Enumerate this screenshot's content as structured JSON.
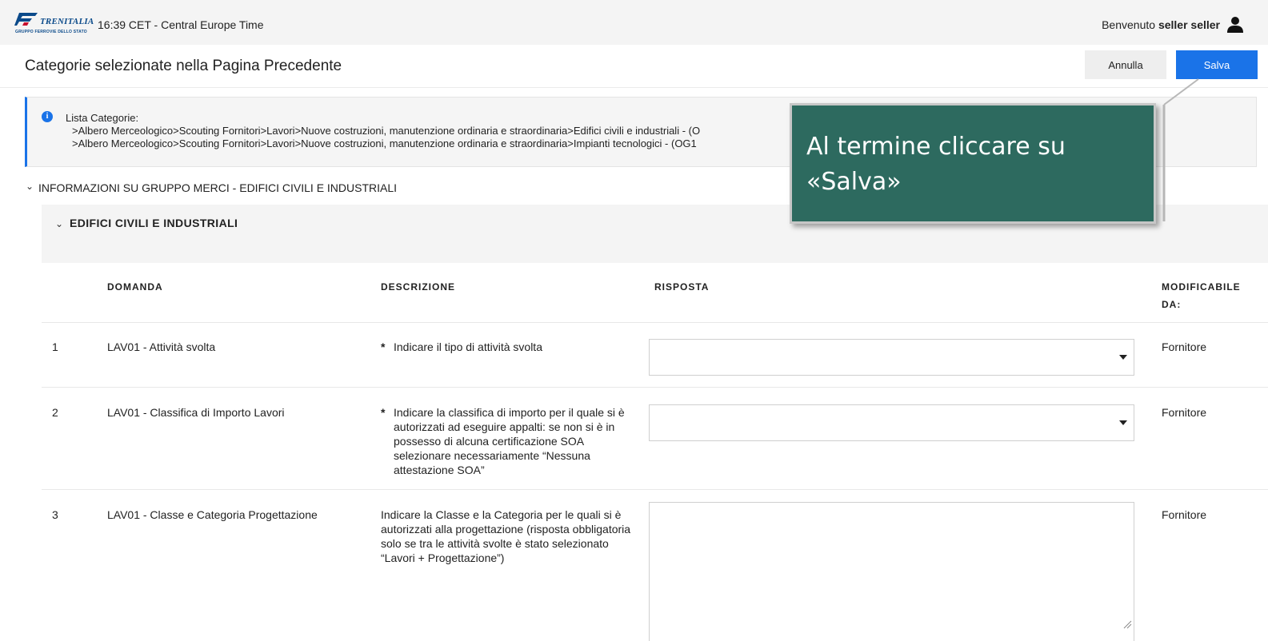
{
  "topbar": {
    "brand": "TRENITALIA",
    "brand_sub": "GRUPPO FERROVIE DELLO STATO",
    "clock": "16:39 CET - Central Europe Time",
    "welcome_prefix": "Benvenuto",
    "welcome_user": "seller seller",
    "user_icon": "user-icon"
  },
  "header": {
    "title": "Categorie selezionate nella Pagina Precedente",
    "cancel_label": "Annulla",
    "save_label": "Salva"
  },
  "info": {
    "icon": "info-icon",
    "title": "Lista Categorie:",
    "line1": ">Albero Merceologico>Scouting Fornitori>Lavori>Nuove costruzioni, manutenzione ordinaria e straordinaria>Edifici civili e industriali - (O",
    "line2": ">Albero Merceologico>Scouting Fornitori>Lavori>Nuove costruzioni, manutenzione ordinaria e straordinaria>Impianti tecnologici - (OG1"
  },
  "section": {
    "title": "INFORMAZIONI SU GRUPPO MERCI - EDIFICI CIVILI E INDUSTRIALI",
    "group_title": "EDIFICI CIVILI E INDUSTRIALI"
  },
  "table": {
    "headers": {
      "domanda": "DOMANDA",
      "descrizione": "DESCRIZIONE",
      "risposta": "RISPOSTA",
      "modificabile_1": "MODIFICABILE",
      "modificabile_2": "DA:"
    },
    "rows": [
      {
        "num": "1",
        "domanda": "LAV01 - Attività svolta",
        "required": "*",
        "descrizione": "Indicare il tipo di attività svolta",
        "risposta": "",
        "modificabile": "Fornitore"
      },
      {
        "num": "2",
        "domanda": "LAV01 - Classifica di Importo Lavori",
        "required": "*",
        "descrizione": "Indicare la classifica di importo per il quale si è autorizzati ad eseguire appalti: se non si è in possesso di alcuna certificazione SOA selezionare necessariamente “Nessuna attestazione SOA”",
        "risposta": "",
        "modificabile": "Fornitore"
      },
      {
        "num": "3",
        "domanda": "LAV01 - Classe e Categoria Progettazione",
        "descrizione": "Indicare la Classe e la Categoria per le quali si è autorizzati alla progettazione (risposta obbligatoria solo se tra le attività svolte è stato selezionato “Lavori + Progettazione”)",
        "risposta": "",
        "modificabile": "Fornitore"
      }
    ]
  },
  "callout": {
    "text": "Al termine cliccare su «Salva»",
    "bg_color": "#2d6a5f"
  },
  "colors": {
    "primary": "#1a73e8",
    "topbar_bg": "#f4f4f4"
  }
}
